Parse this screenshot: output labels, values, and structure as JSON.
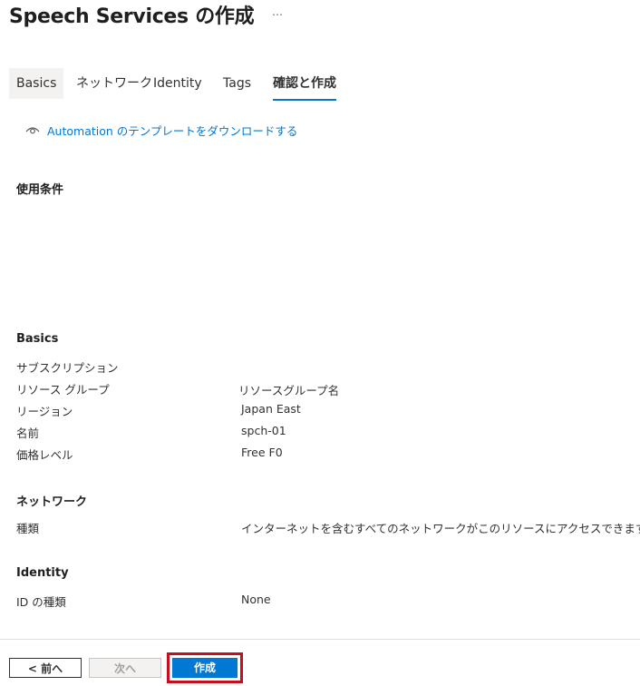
{
  "header": {
    "title": "Speech Services の作成",
    "more": "…"
  },
  "tabs": [
    {
      "label": "Basics"
    },
    {
      "label": "ネットワーク"
    },
    {
      "label": "Identity"
    },
    {
      "label": "Tags"
    },
    {
      "label": "確認と作成"
    }
  ],
  "automation_link": "Automation のテンプレートをダウンロードする",
  "terms": {
    "heading": "使用条件"
  },
  "basics": {
    "heading": "Basics",
    "rows": [
      {
        "label": "サブスクリプション",
        "value": ""
      },
      {
        "label": "リソース グループ",
        "value": "リソースグループ名"
      },
      {
        "label": "リージョン",
        "value": "Japan East"
      },
      {
        "label": "名前",
        "value": "spch-01"
      },
      {
        "label": "価格レベル",
        "value": "Free F0"
      }
    ]
  },
  "network": {
    "heading": "ネットワーク",
    "rows": [
      {
        "label": "種類",
        "value": "インターネットを含むすべてのネットワークがこのリソースにアクセスできます。"
      }
    ]
  },
  "identity": {
    "heading": "Identity",
    "rows": [
      {
        "label": "ID の種類",
        "value": "None"
      }
    ]
  },
  "footer": {
    "prev": "< 前へ",
    "next": "次へ",
    "create": "作成"
  },
  "colors": {
    "accent": "#0078d4",
    "highlight": "#c50f1f"
  }
}
